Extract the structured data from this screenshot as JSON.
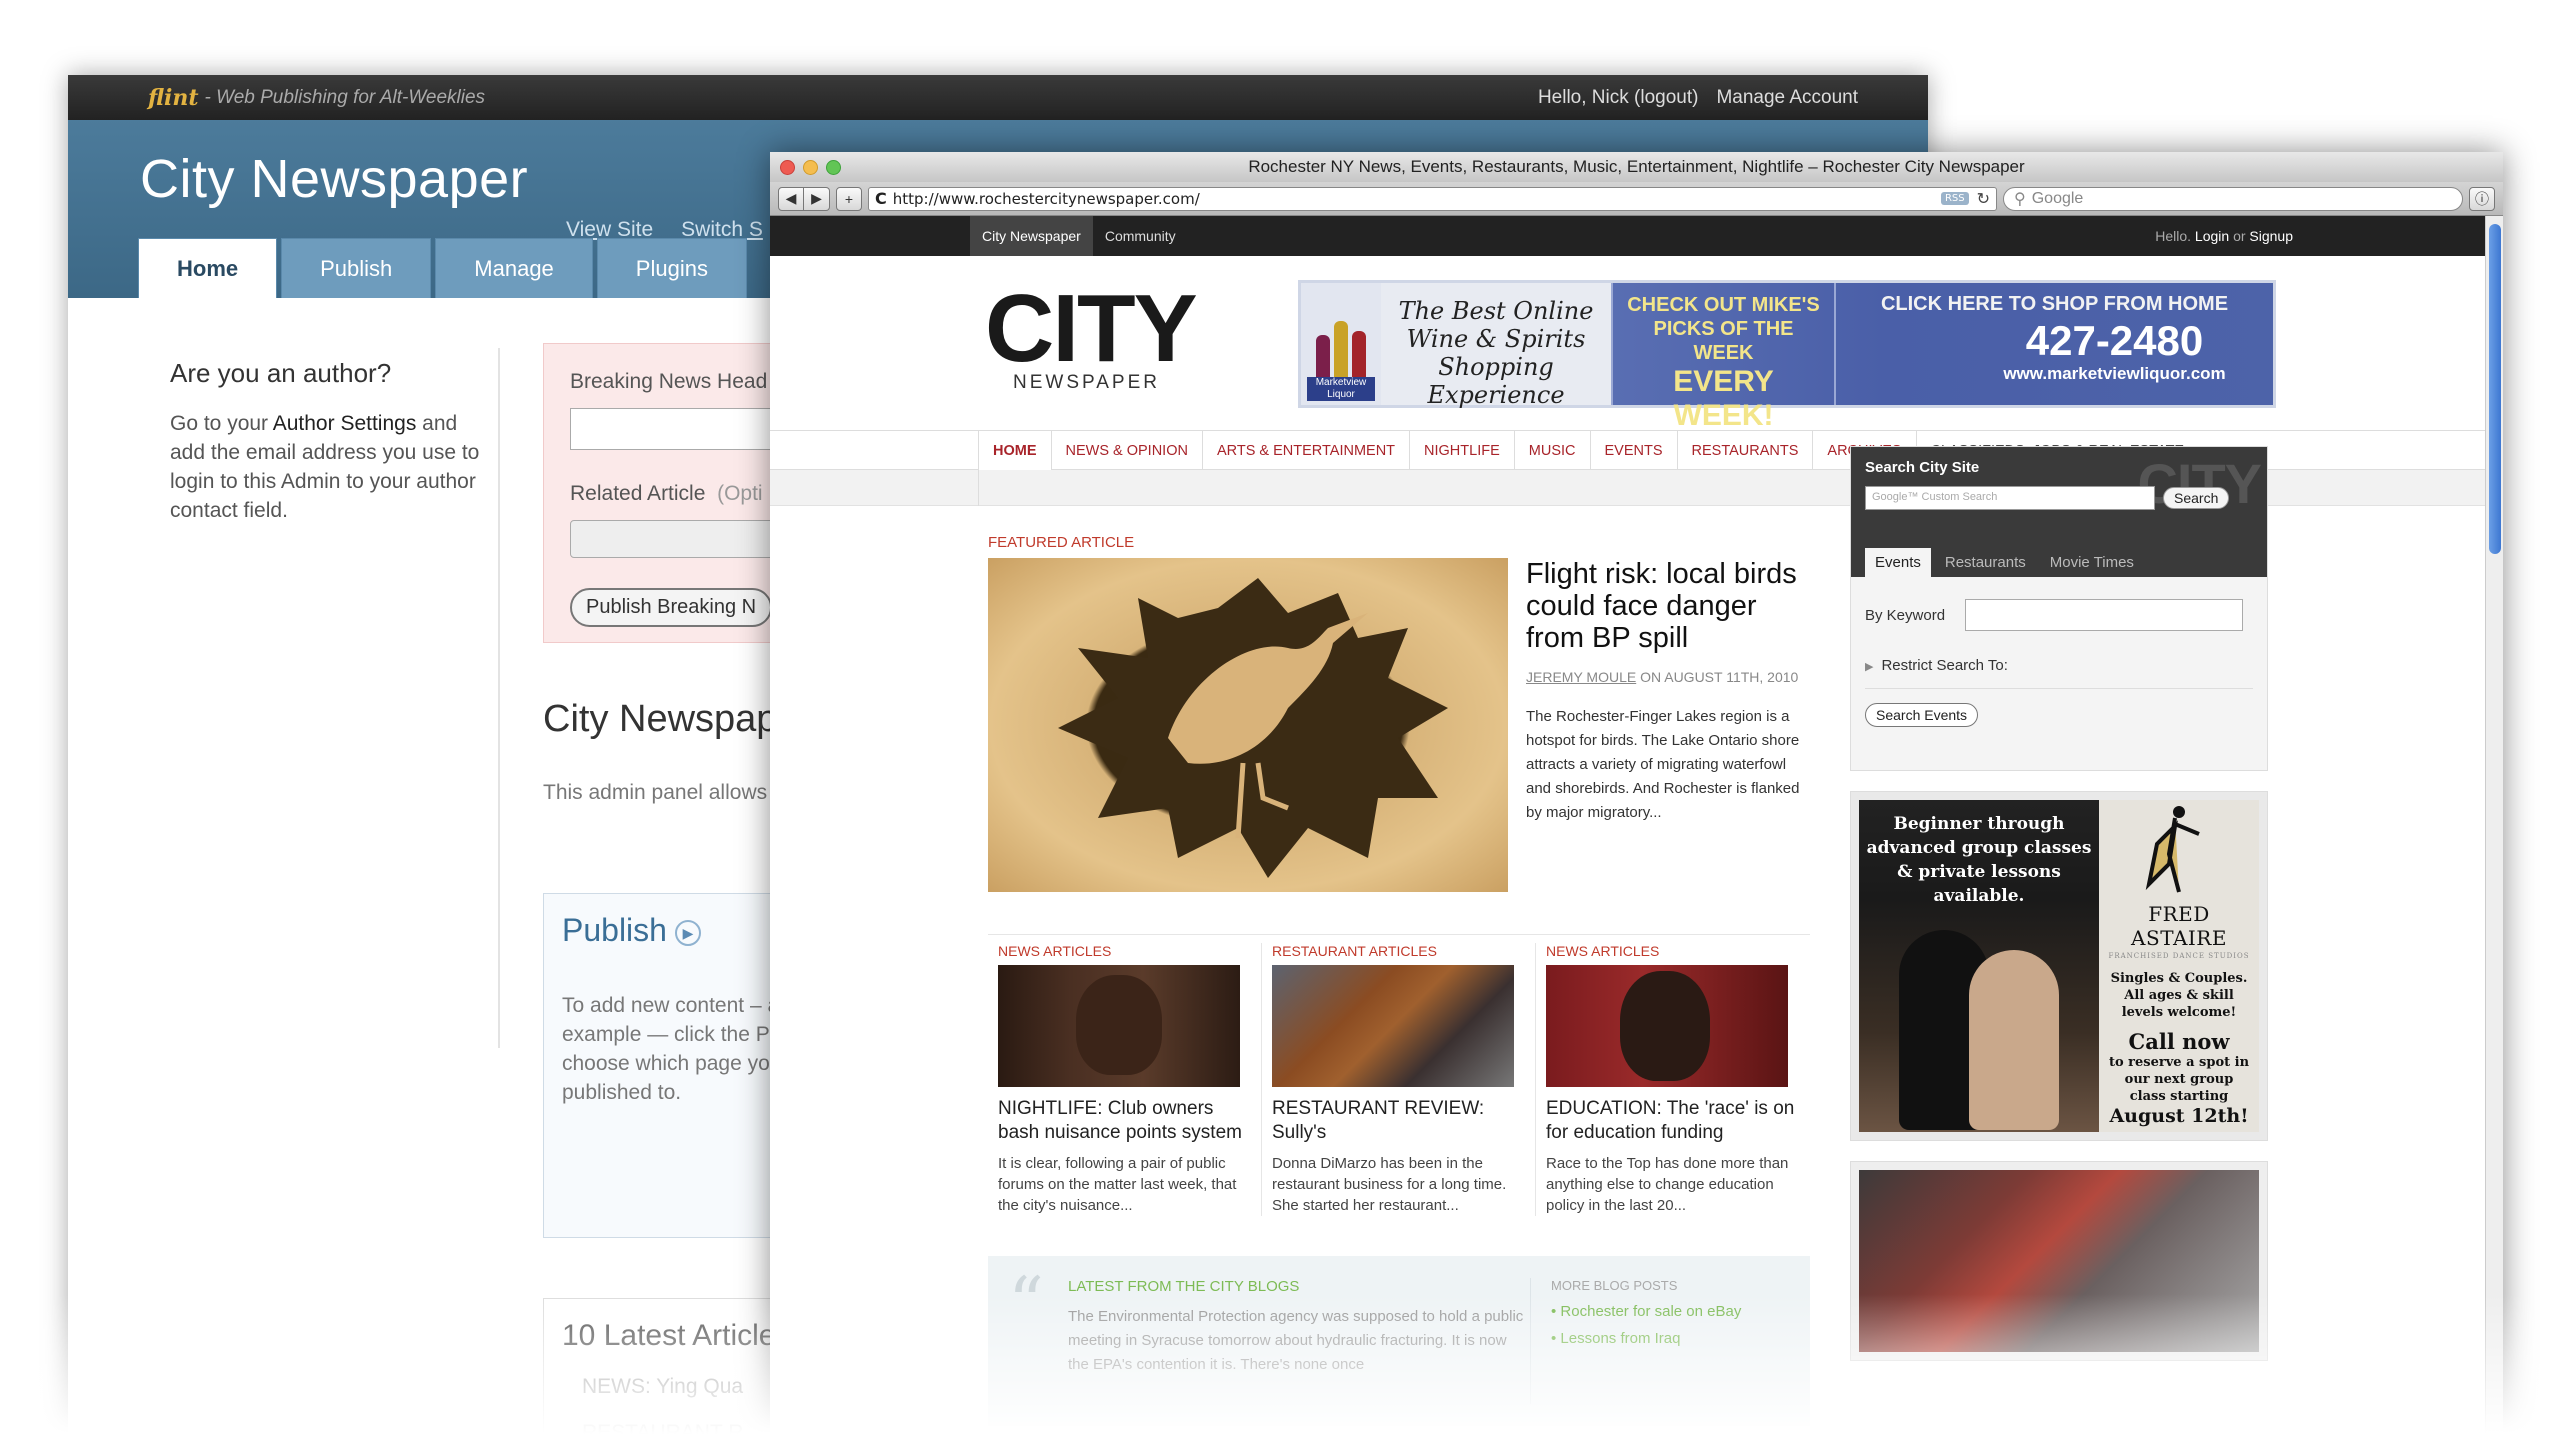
{
  "admin": {
    "brand": "flint",
    "tagline": "- Web Publishing for Alt-Weeklies",
    "hello": "Hello, Nick (logout)",
    "manage_account": "Manage Account",
    "site_title": "City Newspaper",
    "header_links": [
      "View Site",
      "Switch S"
    ],
    "tabs": [
      "Home",
      "Publish",
      "Manage",
      "Plugins"
    ],
    "author_heading": "Are you an author?",
    "author_text_1": "Go to your ",
    "author_settings_link": "Author Settings",
    "author_text_2": " and add the email address you use to login to this Admin to your author contact field.",
    "breaking_label": "Breaking News Head",
    "related_label": "Related Article",
    "related_optional": "(Opti",
    "publish_breaking_button": "Publish Breaking N",
    "section_title": "City Newspap",
    "section_text": "This admin panel allows settings, adjust your site",
    "publish_title": "Publish",
    "publish_text": "To add new content – article or a blog post f example — click the Publish tab. You'll the able to choose which page you'd like the content published to.",
    "latest_title": "10 Latest Articles",
    "latest_items": [
      "NEWS: Ying Qua",
      "RESTAURANT R"
    ]
  },
  "browser": {
    "window_title": "Rochester NY News, Events, Restaurants, Music, Entertainment, Nightlife – Rochester City Newspaper",
    "url": "http://www.rochestercitynewspaper.com/",
    "rss": "RSS",
    "search_placeholder": "Google"
  },
  "site": {
    "top_tabs": [
      "City Newspaper",
      "Community"
    ],
    "login_hello": "Hello.",
    "login": "Login",
    "login_or": "or",
    "signup": "Signup",
    "logo": "CITY",
    "logo_sub": "NEWSPAPER",
    "banner": {
      "label": "Marketview Liquor",
      "script": "The Best Online Wine & Spirits Shopping Experience",
      "mid_1": "CHECK OUT MIKE'S PICKS OF THE WEEK",
      "mid_2": "EVERY WEEK!",
      "cta": "CLICK HERE TO SHOP FROM HOME",
      "phone": "427-2480",
      "web": "www.marketviewliquor.com"
    },
    "nav": [
      "HOME",
      "NEWS & OPINION",
      "ARTS & ENTERTAINMENT",
      "NIGHTLIFE",
      "MUSIC",
      "EVENTS",
      "RESTAURANTS",
      "ARCHIVES",
      "CLASSIFIEDS, JOBS & REAL ESTATE"
    ],
    "featured_label": "FEATURED ARTICLE",
    "featured": {
      "title": "Flight risk: local birds could face danger from BP spill",
      "author": "JEREMY MOULE",
      "date": "ON AUGUST 11TH, 2010",
      "body": "The Rochester-Finger Lakes region is a hotspot for birds. The Lake Ontario shore attracts a variety of migrating waterfowl and shorebirds. And Rochester is flanked by major migratory..."
    },
    "cards": [
      {
        "label": "NEWS ARTICLES",
        "title": "NIGHTLIFE: Club owners bash nuisance points system",
        "body": "It is clear, following a pair of public forums on the matter last week, that the city's nuisance..."
      },
      {
        "label": "RESTAURANT ARTICLES",
        "title": "RESTAURANT REVIEW: Sully's",
        "body": "Donna DiMarzo has been in the restaurant business for a long time. She started her restaurant..."
      },
      {
        "label": "NEWS ARTICLES",
        "title": "EDUCATION: The 'race' is on for education funding",
        "body": "Race to the Top has done more than anything else to change education policy in the last 20..."
      }
    ],
    "blogs": {
      "title": "LATEST FROM THE CITY BLOGS",
      "text": "The Environmental Protection agency was supposed to hold a public meeting in Syracuse tomorrow about hydraulic fracturing. It is now the EPA's contention it is. There's none once",
      "more_title": "MORE BLOG POSTS",
      "more": [
        "Rochester for sale on eBay",
        "Lessons from Iraq"
      ]
    },
    "search": {
      "title": "Search City Site",
      "ghost": "CITY",
      "placeholder": "Google™ Custom Search",
      "button": "Search",
      "tabs": [
        "Events",
        "Restaurants",
        "Movie Times"
      ],
      "keyword_label": "By Keyword",
      "restrict": "Restrict Search To:",
      "events_button": "Search Events"
    },
    "ad": {
      "left": "Beginner through advanced group classes & private lessons available.",
      "brand": "FRED ASTAIRE",
      "brand_sub": "FRANCHISED DANCE STUDIOS",
      "copy": "Singles & Couples. All ages & skill levels welcome!",
      "call": "Call now",
      "copy2": "to reserve a spot in our next group class starting",
      "date": "August 12th!"
    }
  }
}
